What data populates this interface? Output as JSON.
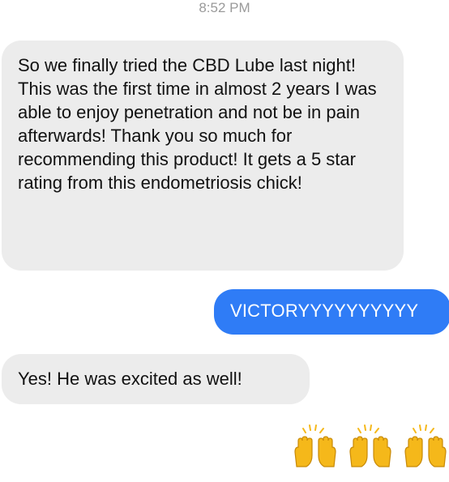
{
  "status": {
    "time": "8:52 PM"
  },
  "messages": [
    {
      "direction": "received",
      "text": "So we finally tried the CBD Lube last night! This was the first time in almost 2 years I was able to enjoy penetration and not be in pain afterwards! Thank you so much for recommending this product! It gets a 5 star rating from this endometriosis chick!"
    },
    {
      "direction": "sent",
      "text": "VICTORYYYYYYYYYY"
    },
    {
      "direction": "received",
      "text": "Yes! He was excited as well!"
    }
  ],
  "reaction": {
    "icon": "raising-hands-icon",
    "count": 3
  },
  "colors": {
    "sent_bubble": "#2f7cf6",
    "received_bubble": "#ececec",
    "timestamp": "#9a9a9a",
    "emoji": "#f5b81a"
  }
}
